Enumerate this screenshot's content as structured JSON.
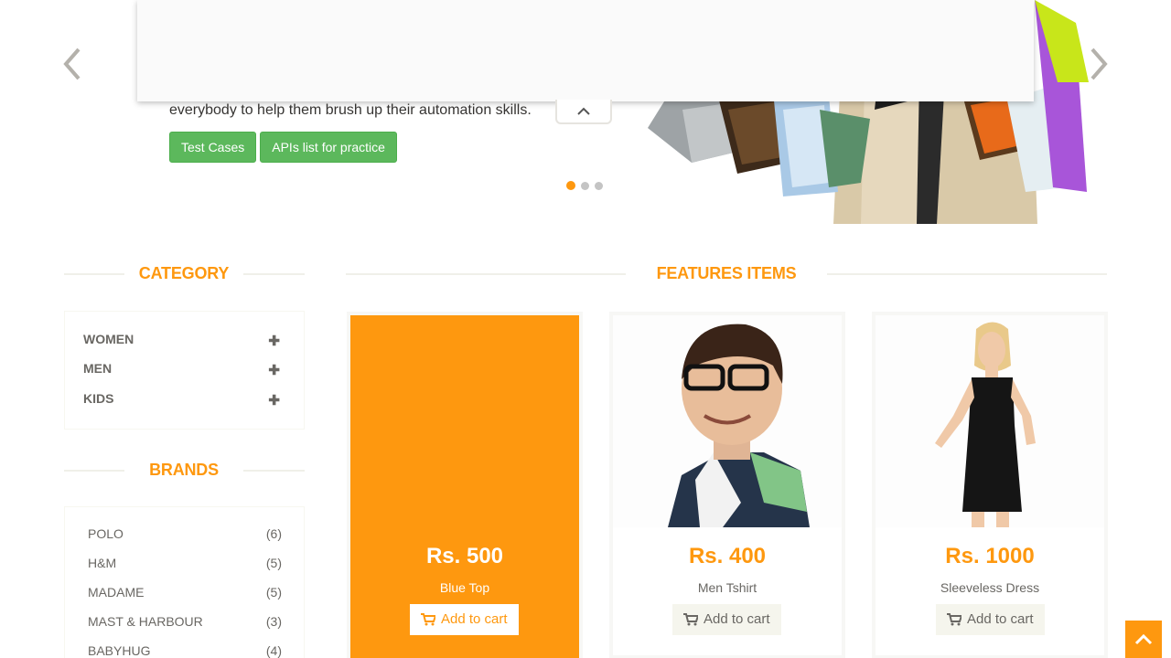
{
  "slider": {
    "text": "everybody to help them brush up their automation skills.",
    "buttons": [
      "Test Cases",
      "APIs list for practice"
    ],
    "icons": {
      "prev": "chevron-left-icon",
      "next": "chevron-right-icon",
      "collapse": "chevron-up-icon"
    },
    "active_dot": 1
  },
  "category": {
    "title": "Category",
    "items": [
      {
        "label": "Women",
        "icon": "plus-icon"
      },
      {
        "label": "Men",
        "icon": "plus-icon"
      },
      {
        "label": "Kids",
        "icon": "plus-icon"
      }
    ]
  },
  "brands": {
    "title": "Brands",
    "items": [
      {
        "name": "Polo",
        "count": "(6)"
      },
      {
        "name": "H&M",
        "count": "(5)"
      },
      {
        "name": "Madame",
        "count": "(5)"
      },
      {
        "name": "Mast & Harbour",
        "count": "(3)"
      },
      {
        "name": "Babyhug",
        "count": "(4)"
      }
    ]
  },
  "features": {
    "title": "Features Items",
    "products": [
      {
        "price": "Rs. 500",
        "name": "Blue Top",
        "cart_label": "Add to cart"
      },
      {
        "price": "Rs. 400",
        "name": "Men Tshirt",
        "cart_label": "Add to cart"
      },
      {
        "price": "Rs. 1000",
        "name": "Sleeveless Dress",
        "cart_label": "Add to cart"
      }
    ]
  },
  "colors": {
    "accent": "#fe980f",
    "button_green": "#5cb85c",
    "text": "#696763",
    "cart_bg": "#f5f5ed"
  }
}
